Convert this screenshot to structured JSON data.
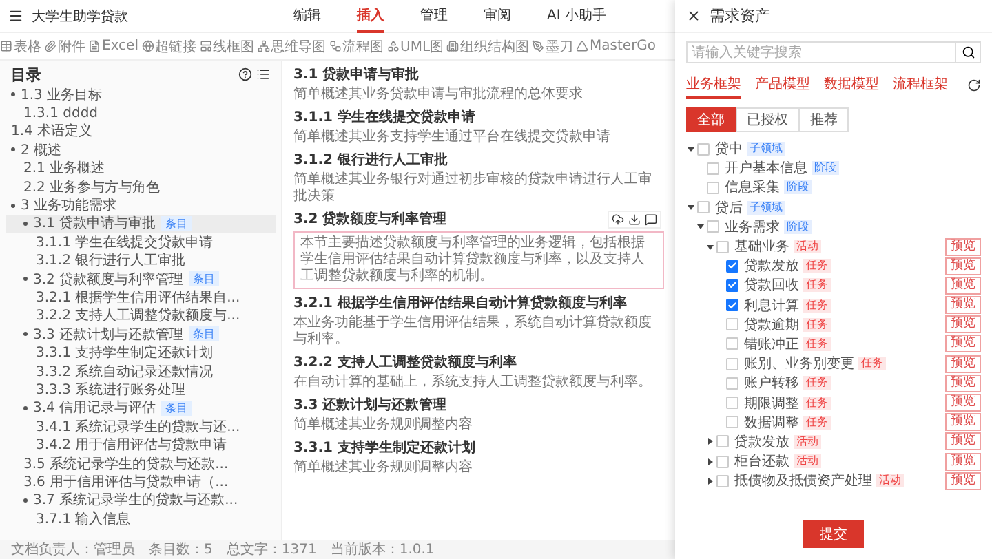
{
  "app": {
    "title": "大学生助学贷款",
    "nav": [
      {
        "label": "编辑",
        "selected": false
      },
      {
        "label": "插入",
        "selected": true
      },
      {
        "label": "管理",
        "selected": false
      },
      {
        "label": "审阅",
        "selected": false
      },
      {
        "label": "AI 小助手",
        "selected": false
      }
    ]
  },
  "toolbar": [
    {
      "label": "表格",
      "kind": "table"
    },
    {
      "label": "附件",
      "kind": "attach"
    },
    {
      "label": "Excel",
      "kind": "file"
    },
    {
      "label": "超链接",
      "kind": "link"
    },
    {
      "label": "线框图",
      "kind": "frame"
    },
    {
      "label": "思维导图",
      "kind": "mind"
    },
    {
      "label": "流程图",
      "kind": "flow"
    },
    {
      "label": "UML图",
      "kind": "uml"
    },
    {
      "label": "组织结构图",
      "kind": "org"
    },
    {
      "label": "墨刀",
      "kind": "pen"
    },
    {
      "label": "MasterGo",
      "kind": "mastergo"
    }
  ],
  "outline": {
    "title": "目录",
    "items": [
      {
        "label": "1.3 业务目标",
        "selected": false,
        "expanded": true,
        "children": [
          {
            "label": "1.3.1 dddd",
            "selected": false
          }
        ]
      },
      {
        "label": "1.4 术语定义",
        "selected": false
      },
      {
        "label": "2 概述",
        "selected": false,
        "expanded": true,
        "children": [
          {
            "label": "2.1 业务概述",
            "selected": false
          },
          {
            "label": "2.2 业务参与方与角色",
            "selected": false
          }
        ]
      },
      {
        "label": "3 业务功能需求",
        "selected": false,
        "expanded": true,
        "children": [
          {
            "label": "3.1 贷款申请与审批",
            "badge": "条目",
            "selected": true,
            "expanded": true,
            "children": [
              {
                "label": "3.1.1 学生在线提交贷款申请",
                "selected": false
              },
              {
                "label": "3.1.2 银行进行人工审批",
                "selected": false
              }
            ]
          },
          {
            "label": "3.2 贷款额度与利率管理",
            "badge": "条目",
            "selected": false,
            "expanded": true,
            "children": [
              {
                "label": "3.2.1 根据学生信用评估结果自...",
                "selected": false
              },
              {
                "label": "3.2.2 支持人工调整贷款额度与...",
                "selected": false
              }
            ]
          },
          {
            "label": "3.3 还款计划与还款管理",
            "badge": "条目",
            "selected": false,
            "expanded": true,
            "children": [
              {
                "label": "3.3.1 支持学生制定还款计划",
                "selected": false
              },
              {
                "label": "3.3.2 系统自动记录还款情况",
                "selected": false
              },
              {
                "label": "3.3.3 系统进行账务处理",
                "selected": false
              }
            ]
          },
          {
            "label": "3.4 信用记录与评估",
            "badge": "条目",
            "selected": false,
            "expanded": true,
            "children": [
              {
                "label": "3.4.1 系统记录学生的贷款与还...",
                "selected": false
              },
              {
                "label": "3.4.2 用于信用评估与贷款申请",
                "selected": false
              }
            ]
          },
          {
            "label": "3.5 系统记录学生的贷款与还款...",
            "selected": false
          },
          {
            "label": "3.6 用于信用评估与贷款申请（...",
            "selected": false
          },
          {
            "label": "3.7 系统记录学生的贷款与还款...",
            "selected": false,
            "expanded": true,
            "children": [
              {
                "label": "3.7.1 输入信息",
                "selected": false
              }
            ]
          }
        ]
      }
    ]
  },
  "document": [
    {
      "kind": "heading",
      "text": "3.1 贷款申请与审批"
    },
    {
      "kind": "paragraph",
      "text": "简单概述其业务贷款申请与审批流程的总体要求"
    },
    {
      "kind": "heading",
      "text": "3.1.1 学生在线提交贷款申请"
    },
    {
      "kind": "paragraph",
      "text": "简单概述其业务支持学生通过平台在线提交贷款申请"
    },
    {
      "kind": "heading",
      "text": "3.1.2 银行进行人工审批"
    },
    {
      "kind": "paragraph",
      "text": "简单概述其业务银行对通过初步审核的贷款申请进行人工审批决策"
    },
    {
      "kind": "heading",
      "text": "3.2 贷款额度与利率管理"
    },
    {
      "kind": "callout",
      "text": "本节主要描述贷款额度与利率管理的业务逻辑，包括根据学生信用评估结果自动计算贷款额度与利率，以及支持人工调整贷款额度与利率的机制。"
    },
    {
      "kind": "heading",
      "text": "3.2.1 根据学生信用评估结果自动计算贷款额度与利率"
    },
    {
      "kind": "paragraph",
      "text": "本业务功能基于学生信用评估结果，系统自动计算贷款额度与利率。"
    },
    {
      "kind": "heading",
      "text": "3.2.2 支持人工调整贷款额度与利率"
    },
    {
      "kind": "paragraph",
      "text": "在自动计算的基础上，系统支持人工调整贷款额度与利率。"
    },
    {
      "kind": "heading",
      "text": "3.3 还款计划与还款管理"
    },
    {
      "kind": "paragraph",
      "text": "简单概述其业务规则调整内容"
    },
    {
      "kind": "heading",
      "text": "3.3.1 支持学生制定还款计划"
    },
    {
      "kind": "paragraph",
      "text": "简单概述其业务规则调整内容"
    }
  ],
  "status_bar": [
    "文档负责人：管理员",
    "条目数：5",
    "总文字：1371",
    "当前版本：1.0.1"
  ],
  "drawer": {
    "title": "需求资产",
    "search": {
      "placeholder": "请输入关键字搜索"
    },
    "tabs": [
      {
        "label": "业务框架",
        "selected": true
      },
      {
        "label": "产品模型",
        "selected": false
      },
      {
        "label": "数据模型",
        "selected": false
      },
      {
        "label": "流程框架",
        "selected": false
      }
    ],
    "filters": [
      {
        "label": "全部",
        "selected": true
      },
      {
        "label": "已授权",
        "selected": false
      },
      {
        "label": "推荐",
        "selected": false
      }
    ],
    "tree": [
      {
        "label": "贷中",
        "tag": "子领域",
        "color": "#3b82f6",
        "checked": false,
        "expanded": true,
        "children": [
          {
            "label": "开户基本信息",
            "tag": "阶段",
            "color": "#3b82f6",
            "checked": false
          },
          {
            "label": "信息采集",
            "tag": "阶段",
            "color": "#3b82f6",
            "checked": false
          }
        ]
      },
      {
        "label": "贷后",
        "tag": "子领域",
        "color": "#3b82f6",
        "checked": false,
        "expanded": true,
        "children": [
          {
            "label": "业务需求",
            "tag": "阶段",
            "color": "#3b82f6",
            "checked": false,
            "expanded": true,
            "children": [
              {
                "label": "基础业务",
                "tag": "活动",
                "color": "#ef4444",
                "checked": false,
                "expanded": true,
                "preview": "预览",
                "children": [
                  {
                    "label": "贷款发放",
                    "tag": "任务",
                    "color": "#ef4444",
                    "checked": true,
                    "preview": "预览"
                  },
                  {
                    "label": "贷款回收",
                    "tag": "任务",
                    "color": "#ef4444",
                    "checked": true,
                    "preview": "预览"
                  },
                  {
                    "label": "利息计算",
                    "tag": "任务",
                    "color": "#ef4444",
                    "checked": true,
                    "preview": "预览"
                  },
                  {
                    "label": "贷款逾期",
                    "tag": "任务",
                    "color": "#ef4444",
                    "checked": false,
                    "preview": "预览"
                  },
                  {
                    "label": "错账冲正",
                    "tag": "任务",
                    "color": "#ef4444",
                    "checked": false,
                    "preview": "预览"
                  },
                  {
                    "label": "账别、业务别变更",
                    "tag": "任务",
                    "color": "#ef4444",
                    "checked": false,
                    "preview": "预览"
                  },
                  {
                    "label": "账户转移",
                    "tag": "任务",
                    "color": "#ef4444",
                    "checked": false,
                    "preview": "预览"
                  },
                  {
                    "label": "期限调整",
                    "tag": "任务",
                    "color": "#ef4444",
                    "checked": false,
                    "preview": "预览"
                  },
                  {
                    "label": "数据调整",
                    "tag": "任务",
                    "color": "#ef4444",
                    "checked": false,
                    "preview": "预览"
                  }
                ]
              },
              {
                "label": "贷款发放",
                "tag": "活动",
                "color": "#ef4444",
                "checked": false,
                "expanded": false,
                "preview": "预览"
              },
              {
                "label": "柜台还款",
                "tag": "活动",
                "color": "#ef4444",
                "checked": false,
                "expanded": false,
                "preview": "预览"
              },
              {
                "label": "抵债物及抵债资产处理",
                "tag": "活动",
                "color": "#ef4444",
                "checked": false,
                "expanded": false,
                "preview": "预览"
              }
            ]
          }
        ]
      }
    ],
    "submit": "提交"
  }
}
